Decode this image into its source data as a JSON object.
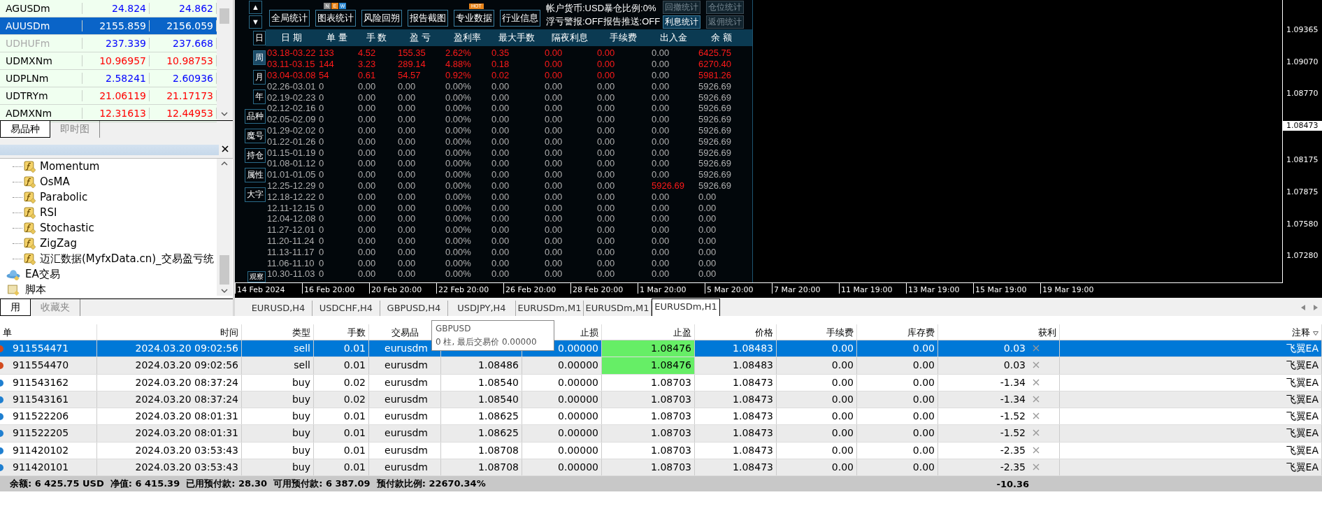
{
  "market_watch": {
    "rows": [
      {
        "symbol": "AGUSDm",
        "bid": "24.824",
        "ask": "24.862",
        "color": "#0000ff",
        "selected": false,
        "dimmed": false
      },
      {
        "symbol": "AUUSDm",
        "bid": "2155.859",
        "ask": "2156.059",
        "selected": true,
        "dimmed": false
      },
      {
        "symbol": "UDHUFm",
        "bid": "237.339",
        "ask": "237.668",
        "color": "#0000ff",
        "selected": false,
        "dimmed": true
      },
      {
        "symbol": "UDMXNm",
        "bid": "10.96957",
        "ask": "10.98753",
        "color": "#ff0000",
        "selected": false,
        "dimmed": false
      },
      {
        "symbol": "UDPLNm",
        "bid": "2.58241",
        "ask": "2.60936",
        "color": "#0000ff",
        "selected": false,
        "dimmed": false
      },
      {
        "symbol": "UDTRYm",
        "bid": "21.06119",
        "ask": "21.17173",
        "color": "#ff0000",
        "selected": false,
        "dimmed": false
      },
      {
        "symbol": "ADMXNm",
        "bid": "12.31613",
        "ask": "12.44953",
        "color": "#ff0000",
        "selected": false,
        "dimmed": false
      }
    ],
    "tabs": [
      {
        "label": "易品种",
        "selected": true
      },
      {
        "label": "即时图",
        "selected": false
      }
    ]
  },
  "navigator": {
    "indicators": [
      "Momentum",
      "OsMA",
      "Parabolic",
      "RSI",
      "Stochastic",
      "ZigZag",
      "迈汇数据(MyfxData.cn)_交易盈亏统"
    ],
    "folders": [
      {
        "label": "EA交易",
        "kind": "experts"
      },
      {
        "label": "脚本",
        "kind": "scripts"
      }
    ],
    "tabs": [
      {
        "label": "用",
        "selected": true
      },
      {
        "label": "收藏夹",
        "selected": false
      }
    ]
  },
  "stats_panel": {
    "scroll_buttons": [
      "▲",
      "▼"
    ],
    "top_buttons": [
      {
        "label": "全局统计"
      },
      {
        "label": "图表统计",
        "badge_letters": [
          "N",
          "E",
          "W"
        ]
      },
      {
        "label": "风险回朔"
      },
      {
        "label": "报告截图"
      },
      {
        "label": "专业数据",
        "badge": "HOT"
      },
      {
        "label": "行业信息"
      }
    ],
    "info_lines": [
      "帐户货币:USD暴仓比例:0%",
      "浮亏警报:OFF报告推送:OFF"
    ],
    "right_buttons": [
      {
        "label": "回撤统计",
        "disabled": true
      },
      {
        "label": "仓位统计",
        "disabled": true
      },
      {
        "label": "利息统计",
        "disabled": false
      },
      {
        "label": "返佣统计",
        "disabled": true
      }
    ],
    "side_buttons": [
      {
        "label": "日",
        "selected": false
      },
      {
        "label": "周",
        "selected": true
      },
      {
        "label": "月",
        "selected": false
      },
      {
        "label": "年",
        "selected": false
      },
      {
        "label": "品种",
        "selected": false
      },
      {
        "label": "魔号",
        "selected": false
      },
      {
        "label": "持仓",
        "selected": false
      },
      {
        "label": "属性",
        "selected": false
      },
      {
        "label": "大字",
        "selected": false
      }
    ],
    "bottom_side_button": "观察",
    "columns": [
      "日 期",
      "单 量",
      "手 数",
      "盈 亏",
      "盈利率",
      "最大手数",
      "隔夜利息",
      "手续费",
      "出入金",
      "余 额"
    ],
    "rows": [
      {
        "values": [
          "03.18-03.22",
          "133",
          "4.52",
          "155.35",
          "2.62%",
          "0.35",
          "0.00",
          "0.00",
          "0.00",
          "6425.75"
        ],
        "highlighted": true,
        "deposit_highlighted": false
      },
      {
        "values": [
          "03.11-03.15",
          "144",
          "3.23",
          "289.14",
          "4.88%",
          "0.18",
          "0.00",
          "0.00",
          "0.00",
          "6270.40"
        ],
        "highlighted": true,
        "deposit_highlighted": false
      },
      {
        "values": [
          "03.04-03.08",
          "54",
          "0.61",
          "54.57",
          "0.92%",
          "0.02",
          "0.00",
          "0.00",
          "0.00",
          "5981.26"
        ],
        "highlighted": true,
        "deposit_highlighted": false
      },
      {
        "values": [
          "02.26-03.01",
          "0",
          "0.00",
          "0.00",
          "0.00%",
          "0.00",
          "0.00",
          "0.00",
          "0.00",
          "5926.69"
        ],
        "highlighted": false,
        "deposit_highlighted": false
      },
      {
        "values": [
          "02.19-02.23",
          "0",
          "0.00",
          "0.00",
          "0.00%",
          "0.00",
          "0.00",
          "0.00",
          "0.00",
          "5926.69"
        ],
        "highlighted": false,
        "deposit_highlighted": false
      },
      {
        "values": [
          "02.12-02.16",
          "0",
          "0.00",
          "0.00",
          "0.00%",
          "0.00",
          "0.00",
          "0.00",
          "0.00",
          "5926.69"
        ],
        "highlighted": false,
        "deposit_highlighted": false
      },
      {
        "values": [
          "02.05-02.09",
          "0",
          "0.00",
          "0.00",
          "0.00%",
          "0.00",
          "0.00",
          "0.00",
          "0.00",
          "5926.69"
        ],
        "highlighted": false,
        "deposit_highlighted": false
      },
      {
        "values": [
          "01.29-02.02",
          "0",
          "0.00",
          "0.00",
          "0.00%",
          "0.00",
          "0.00",
          "0.00",
          "0.00",
          "5926.69"
        ],
        "highlighted": false,
        "deposit_highlighted": false
      },
      {
        "values": [
          "01.22-01.26",
          "0",
          "0.00",
          "0.00",
          "0.00%",
          "0.00",
          "0.00",
          "0.00",
          "0.00",
          "5926.69"
        ],
        "highlighted": false,
        "deposit_highlighted": false
      },
      {
        "values": [
          "01.15-01.19",
          "0",
          "0.00",
          "0.00",
          "0.00%",
          "0.00",
          "0.00",
          "0.00",
          "0.00",
          "5926.69"
        ],
        "highlighted": false,
        "deposit_highlighted": false
      },
      {
        "values": [
          "01.08-01.12",
          "0",
          "0.00",
          "0.00",
          "0.00%",
          "0.00",
          "0.00",
          "0.00",
          "0.00",
          "5926.69"
        ],
        "highlighted": false,
        "deposit_highlighted": false
      },
      {
        "values": [
          "01.01-01.05",
          "0",
          "0.00",
          "0.00",
          "0.00%",
          "0.00",
          "0.00",
          "0.00",
          "0.00",
          "5926.69"
        ],
        "highlighted": false,
        "deposit_highlighted": false
      },
      {
        "values": [
          "12.25-12.29",
          "0",
          "0.00",
          "0.00",
          "0.00%",
          "0.00",
          "0.00",
          "0.00",
          "5926.69",
          "5926.69"
        ],
        "highlighted": false,
        "deposit_highlighted": true
      },
      {
        "values": [
          "12.18-12.22",
          "0",
          "0.00",
          "0.00",
          "0.00%",
          "0.00",
          "0.00",
          "0.00",
          "0.00",
          "0.00"
        ],
        "highlighted": false,
        "deposit_highlighted": false
      },
      {
        "values": [
          "12.11-12.15",
          "0",
          "0.00",
          "0.00",
          "0.00%",
          "0.00",
          "0.00",
          "0.00",
          "0.00",
          "0.00"
        ],
        "highlighted": false,
        "deposit_highlighted": false
      },
      {
        "values": [
          "12.04-12.08",
          "0",
          "0.00",
          "0.00",
          "0.00%",
          "0.00",
          "0.00",
          "0.00",
          "0.00",
          "0.00"
        ],
        "highlighted": false,
        "deposit_highlighted": false
      },
      {
        "values": [
          "11.27-12.01",
          "0",
          "0.00",
          "0.00",
          "0.00%",
          "0.00",
          "0.00",
          "0.00",
          "0.00",
          "0.00"
        ],
        "highlighted": false,
        "deposit_highlighted": false
      },
      {
        "values": [
          "11.20-11.24",
          "0",
          "0.00",
          "0.00",
          "0.00%",
          "0.00",
          "0.00",
          "0.00",
          "0.00",
          "0.00"
        ],
        "highlighted": false,
        "deposit_highlighted": false
      },
      {
        "values": [
          "11.13-11.17",
          "0",
          "0.00",
          "0.00",
          "0.00%",
          "0.00",
          "0.00",
          "0.00",
          "0.00",
          "0.00"
        ],
        "highlighted": false,
        "deposit_highlighted": false
      },
      {
        "values": [
          "11.06-11.10",
          "0",
          "0.00",
          "0.00",
          "0.00%",
          "0.00",
          "0.00",
          "0.00",
          "0.00",
          "0.00"
        ],
        "highlighted": false,
        "deposit_highlighted": false
      },
      {
        "values": [
          "10.30-11.03",
          "0",
          "0.00",
          "0.00",
          "0.00%",
          "0.00",
          "0.00",
          "0.00",
          "0.00",
          "0.00"
        ],
        "highlighted": false,
        "deposit_highlighted": false
      }
    ]
  },
  "chart": {
    "price_labels": [
      {
        "text": "1.09365",
        "current": false
      },
      {
        "text": "1.09070",
        "current": false
      },
      {
        "text": "1.08770",
        "current": false
      },
      {
        "text": "1.08473",
        "current": true
      },
      {
        "text": "1.08175",
        "current": false
      },
      {
        "text": "1.07875",
        "current": false
      },
      {
        "text": "1.07580",
        "current": false
      },
      {
        "text": "1.07280",
        "current": false
      }
    ],
    "time_labels": [
      "14 Feb 2024",
      "16 Feb 20:00",
      "20 Feb 20:00",
      "22 Feb 20:00",
      "26 Feb 20:00",
      "28 Feb 20:00",
      "1 Mar 20:00",
      "5 Mar 20:00",
      "7 Mar 20:00",
      "11 Mar 19:00",
      "13 Mar 19:00",
      "15 Mar 19:00",
      "19 Mar 19:00"
    ]
  },
  "chart_tabs": [
    {
      "label": "EURUSD,H4",
      "selected": false
    },
    {
      "label": "USDCHF,H4",
      "selected": false
    },
    {
      "label": "GBPUSD,H4",
      "selected": false
    },
    {
      "label": "USDJPY,H4",
      "selected": false
    },
    {
      "label": "EURUSDm,M1",
      "selected": false
    },
    {
      "label": "EURUSDm,M1",
      "selected": false
    },
    {
      "label": "EURUSDm,H1",
      "selected": true
    }
  ],
  "tooltip": {
    "title": "GBPUSD",
    "text": "0 柱, 最后交易价 0.00000"
  },
  "trade_table": {
    "columns": [
      {
        "label": "单"
      },
      {
        "label": "时间"
      },
      {
        "label": "类型"
      },
      {
        "label": "手数"
      },
      {
        "label": "交易品"
      },
      {},
      {
        "label": "止损"
      },
      {
        "label": "止盈"
      },
      {
        "label": "价格"
      },
      {
        "label": "手续费"
      },
      {
        "label": "库存费"
      },
      {
        "label": "获利"
      },
      {
        "label": "注释"
      }
    ],
    "rows": [
      {
        "kind": "sell",
        "order": "911554471",
        "time": "2024.03.20 09:02:56",
        "type": "sell",
        "lots": "0.01",
        "symbol": "eurusdm",
        "sl": "0.00000",
        "tp": "1.08476",
        "tp_highlighted": true,
        "price": "1.08483",
        "commission": "0.00",
        "swap": "0.00",
        "profit": "0.03",
        "comment": "飞翼EA",
        "selected": true
      },
      {
        "kind": "sell",
        "order": "911554470",
        "time": "2024.03.20 09:02:56",
        "type": "sell",
        "lots": "0.01",
        "symbol": "eurusdm",
        "open_price": "1.08486",
        "sl": "0.00000",
        "tp": "1.08476",
        "tp_highlighted": true,
        "price": "1.08483",
        "commission": "0.00",
        "swap": "0.00",
        "profit": "0.03",
        "comment": "飞翼EA",
        "selected": false
      },
      {
        "kind": "buy",
        "order": "911543162",
        "time": "2024.03.20 08:37:24",
        "type": "buy",
        "lots": "0.02",
        "symbol": "eurusdm",
        "open_price": "1.08540",
        "sl": "0.00000",
        "tp": "1.08703",
        "tp_highlighted": false,
        "price": "1.08473",
        "commission": "0.00",
        "swap": "0.00",
        "profit": "-1.34",
        "comment": "飞翼EA",
        "selected": false
      },
      {
        "kind": "buy",
        "order": "911543161",
        "time": "2024.03.20 08:37:24",
        "type": "buy",
        "lots": "0.02",
        "symbol": "eurusdm",
        "open_price": "1.08540",
        "sl": "0.00000",
        "tp": "1.08703",
        "tp_highlighted": false,
        "price": "1.08473",
        "commission": "0.00",
        "swap": "0.00",
        "profit": "-1.34",
        "comment": "飞翼EA",
        "selected": false
      },
      {
        "kind": "buy",
        "order": "911522206",
        "time": "2024.03.20 08:01:31",
        "type": "buy",
        "lots": "0.01",
        "symbol": "eurusdm",
        "open_price": "1.08625",
        "sl": "0.00000",
        "tp": "1.08703",
        "tp_highlighted": false,
        "price": "1.08473",
        "commission": "0.00",
        "swap": "0.00",
        "profit": "-1.52",
        "comment": "飞翼EA",
        "selected": false
      },
      {
        "kind": "buy",
        "order": "911522205",
        "time": "2024.03.20 08:01:31",
        "type": "buy",
        "lots": "0.01",
        "symbol": "eurusdm",
        "open_price": "1.08625",
        "sl": "0.00000",
        "tp": "1.08703",
        "tp_highlighted": false,
        "price": "1.08473",
        "commission": "0.00",
        "swap": "0.00",
        "profit": "-1.52",
        "comment": "飞翼EA",
        "selected": false
      },
      {
        "kind": "buy",
        "order": "911420102",
        "time": "2024.03.20 03:53:43",
        "type": "buy",
        "lots": "0.01",
        "symbol": "eurusdm",
        "open_price": "1.08708",
        "sl": "0.00000",
        "tp": "1.08703",
        "tp_highlighted": false,
        "price": "1.08473",
        "commission": "0.00",
        "swap": "0.00",
        "profit": "-2.35",
        "comment": "飞翼EA",
        "selected": false
      },
      {
        "kind": "buy",
        "order": "911420101",
        "time": "2024.03.20 03:53:43",
        "type": "buy",
        "lots": "0.01",
        "symbol": "eurusdm",
        "open_price": "1.08708",
        "sl": "0.00000",
        "tp": "1.08703",
        "tp_highlighted": false,
        "price": "1.08473",
        "commission": "0.00",
        "swap": "0.00",
        "profit": "-2.35",
        "comment": "飞翼EA",
        "selected": false
      }
    ],
    "summary": {
      "text": "余额: 6 425.75 USD  净值: 6 415.39  已用预付款: 28.30  可用预付款: 6 387.09  预付款比例: 22670.34%",
      "profit_total": "-10.36"
    }
  }
}
